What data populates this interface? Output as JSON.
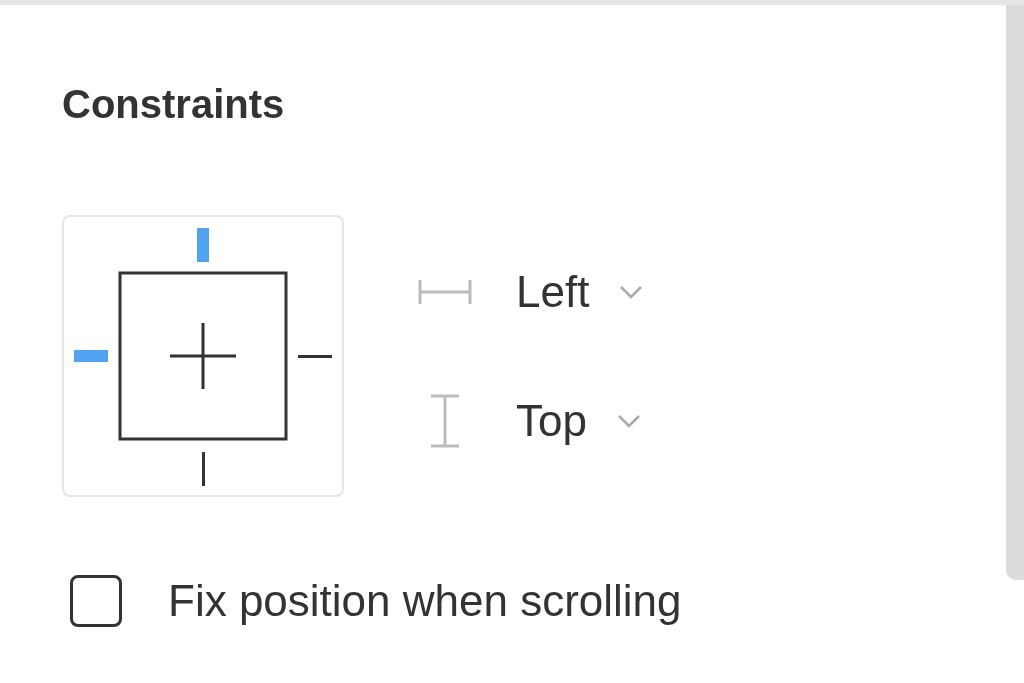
{
  "title": "Constraints",
  "sides": [
    {
      "kind": "top",
      "selected": true
    },
    {
      "kind": "left",
      "selected": true
    },
    {
      "kind": "right",
      "selected": false
    },
    {
      "kind": "bottom",
      "selected": false
    }
  ],
  "dropdowns": [
    {
      "kind": "horizontal",
      "value": "Left"
    },
    {
      "kind": "vertical",
      "value": "Top"
    }
  ],
  "fix_position": {
    "label": "Fix position when scrolling",
    "checked": false
  }
}
